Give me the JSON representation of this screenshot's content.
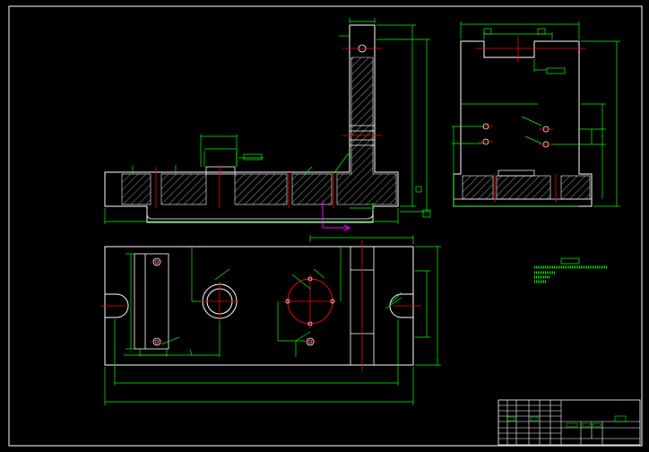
{
  "drawing": {
    "background": "#000000",
    "colors": {
      "outline": "#ffffff",
      "dimension": "#00ff00",
      "centerline": "#ff0000",
      "axis": "#ff00ff",
      "hatch": "#ffffff"
    }
  },
  "title_block": {
    "rows": 9,
    "cols": 6
  }
}
